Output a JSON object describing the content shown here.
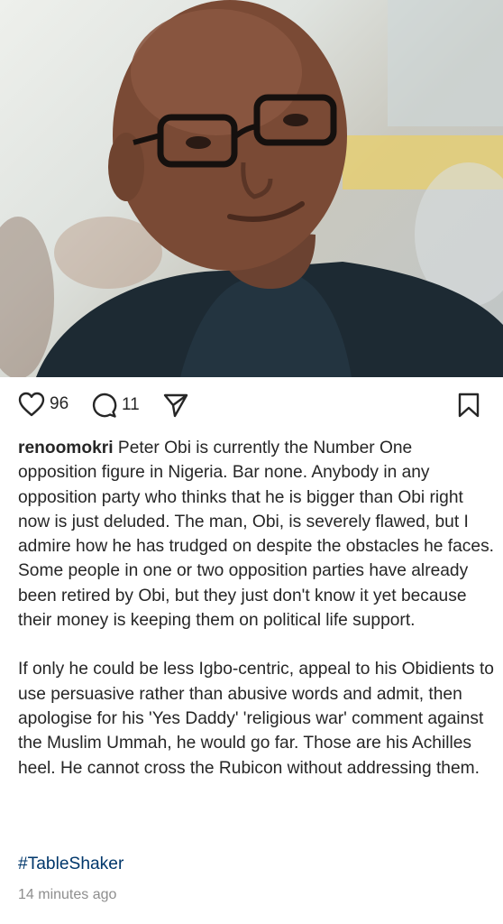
{
  "post": {
    "image": {
      "description": "photo-of-man"
    },
    "actions": {
      "like_icon": "heart-icon",
      "like_count": "96",
      "comment_icon": "comment-icon",
      "comment_count": "11",
      "share_icon": "send-icon",
      "save_icon": "bookmark-icon"
    },
    "caption": {
      "username": "renoomokri",
      "paragraph1": "Peter Obi is currently the Number One opposition figure in Nigeria. Bar none. Anybody in any opposition party who thinks that he is bigger than Obi right now is just deluded. The man, Obi, is severely flawed, but I admire how he has trudged on despite the obstacles he faces. Some people in one or two opposition parties have already been retired by Obi, but they just don't know it yet because their money is keeping them on political life support.",
      "paragraph2": "If only he could be less Igbo-centric, appeal to his Obidients to use persuasive rather than abusive words and admit, then apologise for his 'Yes Daddy' 'religious war' comment against the Muslim Ummah, he would go far. Those are his Achilles heel. He cannot cross the Rubicon without addressing them."
    },
    "hashtag": "#TableShaker",
    "timestamp": "14 minutes ago",
    "colors": {
      "text": "#262626",
      "hashtag": "#00376b",
      "muted": "#8e8e8e"
    }
  }
}
